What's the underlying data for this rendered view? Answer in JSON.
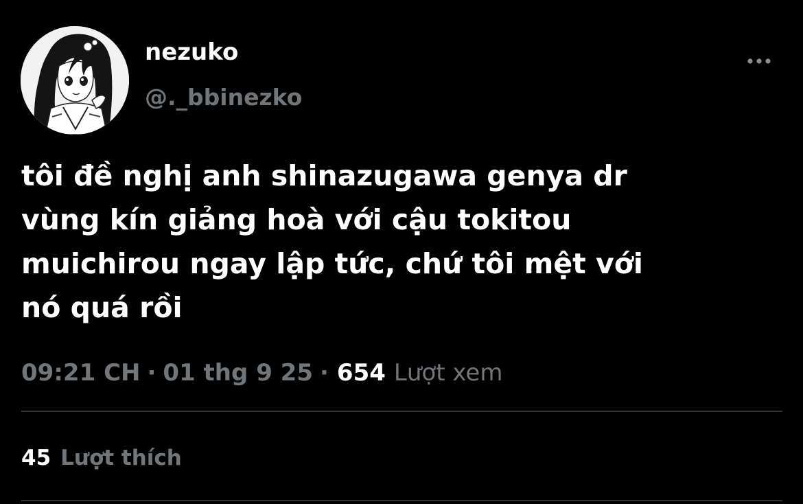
{
  "author": {
    "display_name": "nezuko",
    "handle": "@._bbinezko",
    "avatar_icon": "anime-girl-avatar"
  },
  "more_menu_icon": "more-horizontal-icon",
  "tweet": {
    "text": "tôi đề nghị anh shinazugawa genya dr\nvùng kín giảng hoà với cậu tokitou\nmuichirou ngay lập tức, chứ tôi mệt với\nnó quá rồi"
  },
  "meta": {
    "time": "09:21 CH",
    "separator": "·",
    "date": "01 thg 9 25",
    "views_count": "654",
    "views_label": "Lượt xem"
  },
  "engagement": {
    "likes_count": "45",
    "likes_label": "Lượt thích"
  },
  "colors": {
    "background": "#000000",
    "primary_text": "#ffffff",
    "secondary_text": "#71767b",
    "divider": "#2f3336"
  }
}
